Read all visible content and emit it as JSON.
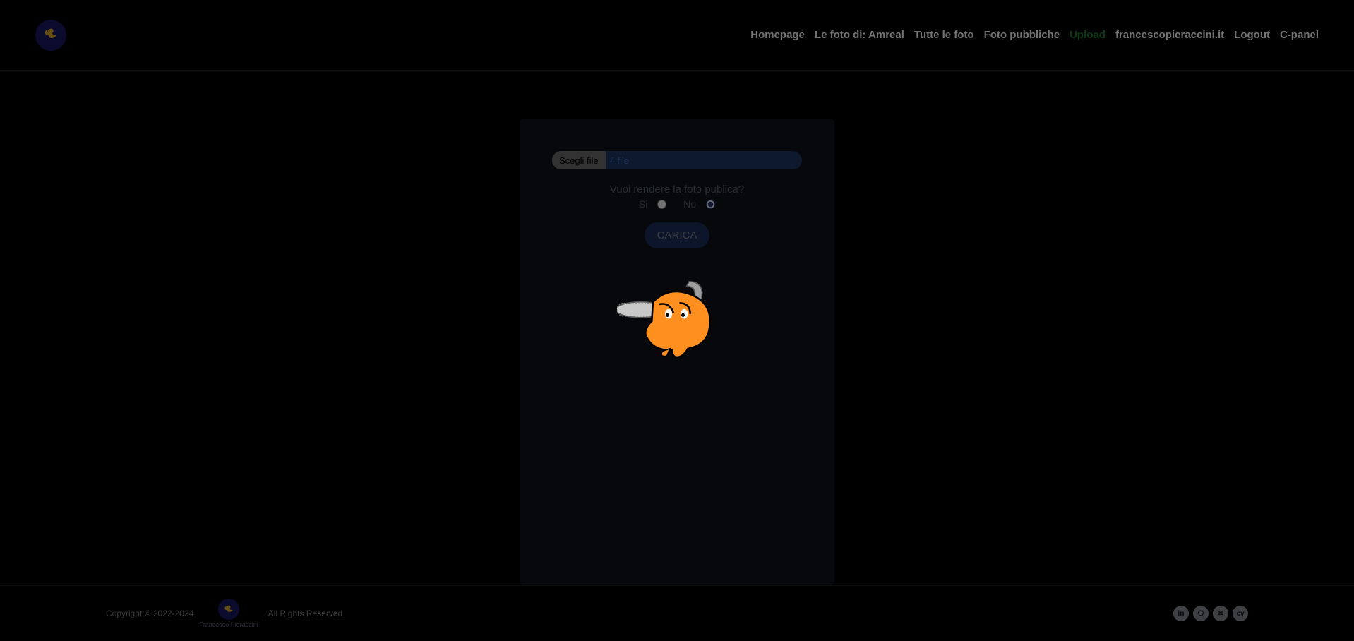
{
  "nav": {
    "items": [
      {
        "label": "Homepage",
        "active": false
      },
      {
        "label": "Le foto di: Amreal",
        "active": false
      },
      {
        "label": "Tutte le foto",
        "active": false
      },
      {
        "label": "Foto pubbliche",
        "active": false
      },
      {
        "label": "Upload",
        "active": true
      },
      {
        "label": "francescopieraccini.it",
        "active": false
      },
      {
        "label": "Logout",
        "active": false
      },
      {
        "label": "C-panel",
        "active": false
      }
    ]
  },
  "form": {
    "choose_label": "Scegli file",
    "file_status": "4 file",
    "question": "Vuoi rendere la foto publica?",
    "yes_label": "Si",
    "no_label": "No",
    "submit_label": "CARICA",
    "public_selected": "no"
  },
  "footer": {
    "left1": "Copyright © 2022-2024",
    "logo_text": "Francesco Pieraccini",
    "left2": ". All Rights Reserved",
    "social": [
      "in",
      "gh",
      "mail",
      "cv"
    ]
  }
}
